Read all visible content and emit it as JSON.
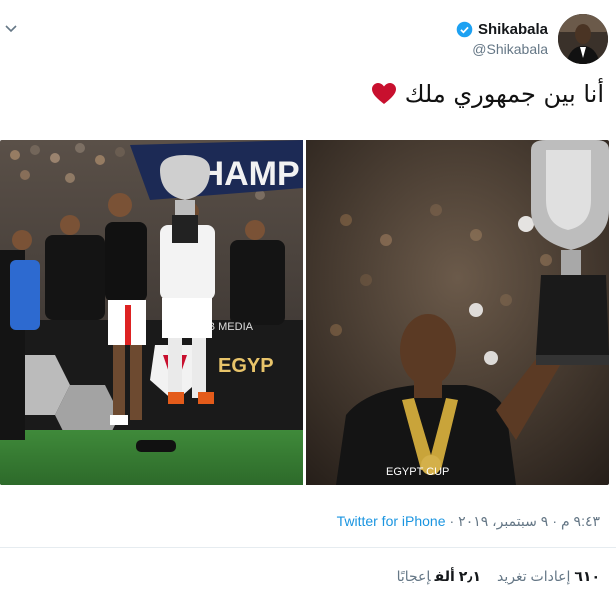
{
  "author": {
    "display_name": "Shikabala",
    "handle": "@Shikabala"
  },
  "tweet": {
    "text": "أنا بين جمهوري ملك"
  },
  "media": {
    "left_watermark": "ماح DIAB MEDIA",
    "left_banner_text": "CHAMP",
    "left_sign_text": "EGYP",
    "right_shirt_text": "EGYPT CUP"
  },
  "meta": {
    "time": "٩:٤٣ م",
    "separator1": "·",
    "date": "٩ سبتمبر، ٢٠١٩",
    "separator2": "·",
    "source": "Twitter for iPhone"
  },
  "stats": {
    "retweets_count": "٦١٠",
    "retweets_label": "إعادات تغريد",
    "likes_count": "٢٫١ ألف",
    "likes_label": "إعجابًا"
  },
  "colors": {
    "accent": "#1b95e0",
    "secondary_text": "#657786",
    "heart": "#e0245e"
  }
}
